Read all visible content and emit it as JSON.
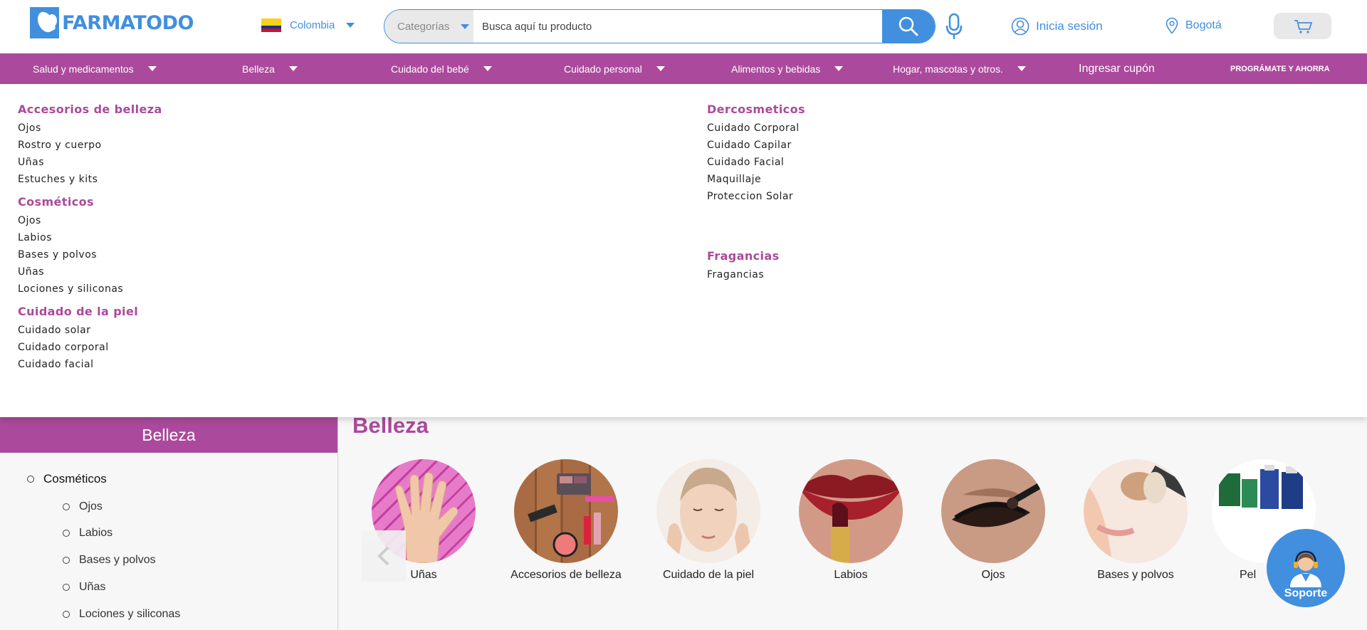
{
  "brand": {
    "name": "FARMATODO",
    "color": "#418fde",
    "accent": "#ab4a9c"
  },
  "header": {
    "country": "Colombia",
    "search": {
      "category": "Categorías",
      "placeholder": "Busca aquí tu producto"
    },
    "login": "Inicia sesión",
    "location": "Bogotá"
  },
  "nav": {
    "items": [
      {
        "label": "Salud y medicamentos"
      },
      {
        "label": "Belleza"
      },
      {
        "label": "Cuidado del bebé"
      },
      {
        "label": "Cuidado personal"
      },
      {
        "label": "Alimentos y bebidas"
      },
      {
        "label": "Hogar, mascotas y otros."
      }
    ],
    "coupon": "Ingresar cupón",
    "programate": "PROGRÁMATE Y AHORRA"
  },
  "mega": {
    "left": [
      {
        "title": "Accesorios de belleza",
        "items": [
          "Ojos",
          "Rostro y cuerpo",
          "Uñas",
          "Estuches y kits"
        ]
      },
      {
        "title": "Cosméticos",
        "items": [
          "Ojos",
          "Labios",
          "Bases y polvos",
          "Uñas",
          "Lociones y siliconas"
        ]
      },
      {
        "title": "Cuidado de la piel",
        "items": [
          "Cuidado solar",
          "Cuidado corporal",
          "Cuidado facial"
        ]
      }
    ],
    "right": [
      {
        "title": "Dercosmeticos",
        "items": [
          "Cuidado Corporal",
          "Cuidado Capilar",
          "Cuidado Facial",
          "Maquillaje",
          "Proteccion Solar"
        ]
      },
      {
        "title": "Fragancias",
        "items": [
          "Fragancias"
        ]
      }
    ]
  },
  "sidebar": {
    "title": "Belleza",
    "parent": "Cosméticos",
    "children": [
      "Ojos",
      "Labios",
      "Bases y polvos",
      "Uñas",
      "Lociones y siliconas"
    ]
  },
  "main": {
    "title": "Belleza",
    "categories": [
      {
        "label": "Uñas"
      },
      {
        "label": "Accesorios de belleza"
      },
      {
        "label": "Cuidado de la piel"
      },
      {
        "label": "Labios"
      },
      {
        "label": "Ojos"
      },
      {
        "label": "Bases y polvos"
      },
      {
        "label": "Pel"
      }
    ]
  },
  "support": {
    "label": "Soporte"
  }
}
